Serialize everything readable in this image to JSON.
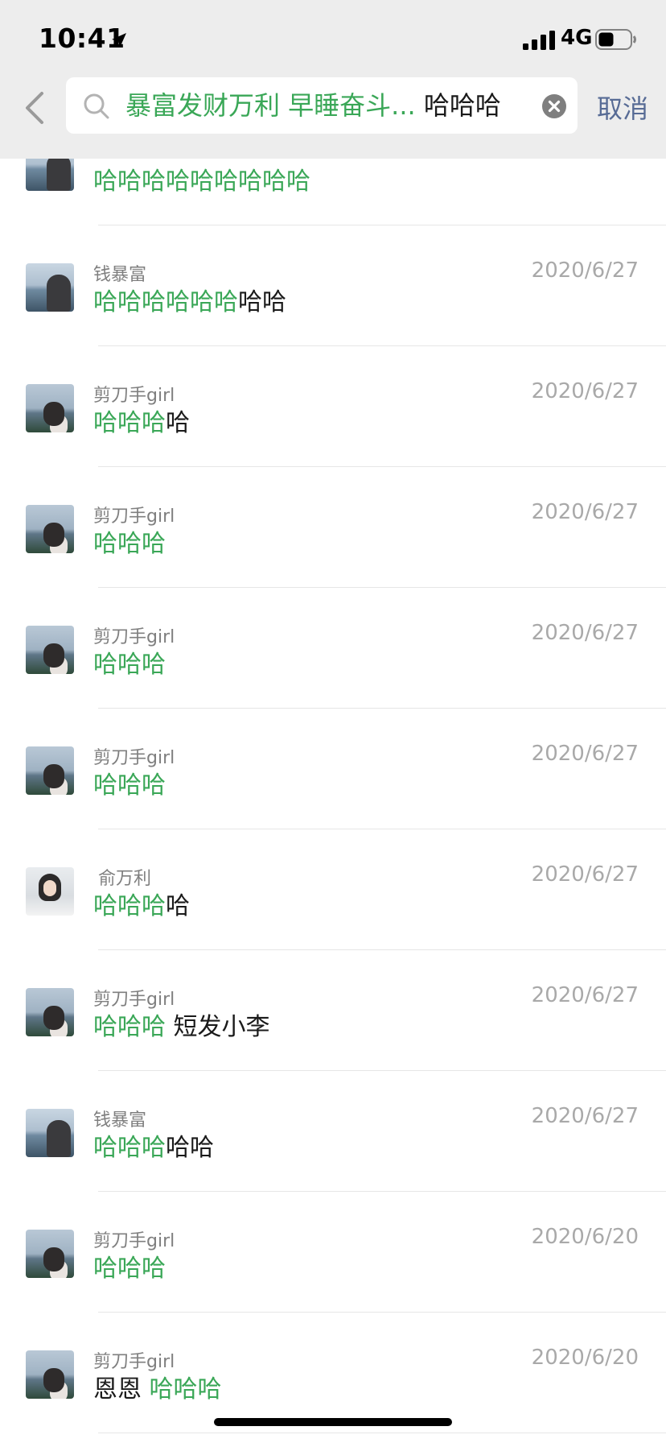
{
  "status": {
    "time": "10:41",
    "network": "4G"
  },
  "search": {
    "query_highlight": "暴富发财万利 早睡奋斗...",
    "query_plain": "哈哈哈",
    "cancel_label": "取消"
  },
  "results": [
    {
      "sender": "",
      "date": "",
      "parts": [
        {
          "t": "哈哈哈哈哈哈哈哈哈",
          "hl": true
        }
      ]
    },
    {
      "sender": "钱暴富",
      "date": "2020/6/27",
      "parts": [
        {
          "t": "哈哈哈哈哈哈",
          "hl": true
        },
        {
          "t": "哈哈",
          "hl": false
        }
      ]
    },
    {
      "sender": "剪刀手girl",
      "date": "2020/6/27",
      "parts": [
        {
          "t": "哈哈哈",
          "hl": true
        },
        {
          "t": "哈",
          "hl": false
        }
      ]
    },
    {
      "sender": "剪刀手girl",
      "date": "2020/6/27",
      "parts": [
        {
          "t": "哈哈哈",
          "hl": true
        }
      ]
    },
    {
      "sender": "剪刀手girl",
      "date": "2020/6/27",
      "parts": [
        {
          "t": "哈哈哈",
          "hl": true
        }
      ]
    },
    {
      "sender": "剪刀手girl",
      "date": "2020/6/27",
      "parts": [
        {
          "t": "哈哈哈",
          "hl": true
        }
      ]
    },
    {
      "sender": "俞万利",
      "date": "2020/6/27",
      "parts": [
        {
          "t": "哈哈哈",
          "hl": true
        },
        {
          "t": "哈",
          "hl": false
        }
      ]
    },
    {
      "sender": "剪刀手girl",
      "date": "2020/6/27",
      "parts": [
        {
          "t": "哈哈哈",
          "hl": true
        },
        {
          "t": " 短发小李",
          "hl": false
        }
      ]
    },
    {
      "sender": "钱暴富",
      "date": "2020/6/27",
      "parts": [
        {
          "t": "哈哈哈",
          "hl": true
        },
        {
          "t": "哈哈",
          "hl": false
        }
      ]
    },
    {
      "sender": "剪刀手girl",
      "date": "2020/6/20",
      "parts": [
        {
          "t": "哈哈哈",
          "hl": true
        }
      ]
    },
    {
      "sender": "剪刀手girl",
      "date": "2020/6/20",
      "parts": [
        {
          "t": "恩恩 ",
          "hl": false
        },
        {
          "t": "哈哈哈",
          "hl": true
        }
      ]
    }
  ],
  "colors": {
    "highlight": "#3aa757",
    "link": "#576b95",
    "header_bg": "#ededed"
  }
}
